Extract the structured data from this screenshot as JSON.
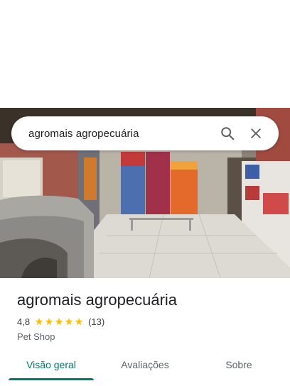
{
  "search": {
    "query": "agromais agropecuária",
    "search_icon": "search-icon",
    "clear_icon": "close-icon"
  },
  "place": {
    "name": "agromais agropecuária",
    "rating": "4,8",
    "stars": 5,
    "review_count": "(13)",
    "category": "Pet Shop"
  },
  "tabs": [
    {
      "label": "Visão geral",
      "active": true
    },
    {
      "label": "Avaliações",
      "active": false
    },
    {
      "label": "Sobre",
      "active": false
    }
  ],
  "colors": {
    "accent": "#00796b",
    "star": "#fbbc04"
  }
}
